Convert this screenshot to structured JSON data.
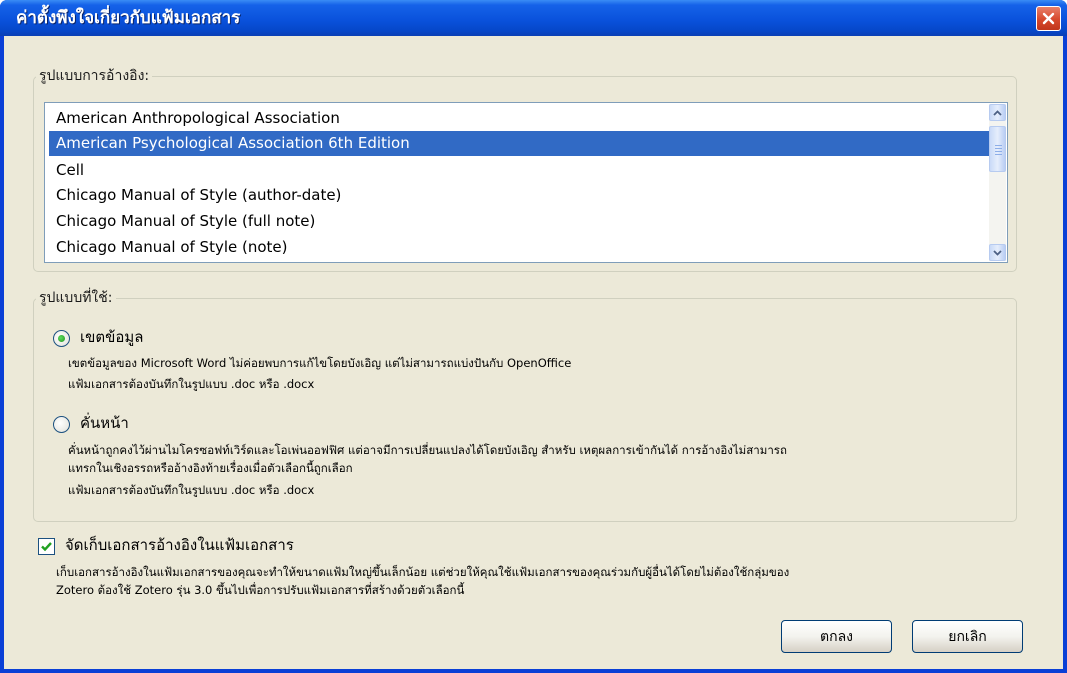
{
  "window": {
    "title": "ค่าตั้งพึงใจเกี่ยวกับแฟ้มเอกสาร"
  },
  "citation_style": {
    "legend": "รูปแบบการอ้างอิง:",
    "items": [
      "American Anthropological Association",
      "American Psychological Association 6th Edition",
      "Cell",
      "Chicago Manual of Style (author-date)",
      "Chicago Manual of Style (full note)",
      "Chicago Manual of Style (note)"
    ],
    "selected_index": 1
  },
  "format": {
    "legend": "รูปแบบที่ใช้:",
    "fields_option": {
      "label": "เขตข้อมูล",
      "checked": true,
      "desc_line1": "เขตข้อมูลของ Microsoft Word ไม่ค่อยพบการแก้ไขโดยบังเอิญ แต่ไม่สามารถแบ่งปันกับ OpenOffice",
      "desc_line2": "แฟ้มเอกสารต้องบันทึกในรูปแบบ .doc หรือ .docx"
    },
    "bookmarks_option": {
      "label": "คั่นหน้า",
      "checked": false,
      "desc_line1": "คั่นหน้าถูกคงไว้ผ่านไมโครซอฟท์เวิร์ดและโอเพ่นออฟฟิศ แต่อาจมีการเปลี่ยนแปลงได้โดยบังเอิญ สำหรับ เหตุผลการเข้ากันได้ การอ้างอิงไม่สามารถ",
      "desc_line2": "แทรกในเชิงอรรถหรืออ้างอิงท้ายเรื่องเมื่อตัวเลือกนี้ถูกเลือก",
      "desc_line3": "แฟ้มเอกสารต้องบันทึกในรูปแบบ .doc หรือ .docx"
    }
  },
  "store_references": {
    "label": "จัดเก็บเอกสารอ้างอิงในแฟ้มเอกสาร",
    "checked": true,
    "desc_line1": "เก็บเอกสารอ้างอิงในแฟ้มเอกสารของคุณจะทำให้ขนาดแฟ้มใหญ่ขึ้นเล็กน้อย แต่ช่วยให้คุณใช้แฟ้มเอกสารของคุณร่วมกับผู้อื่นได้โดยไม่ต้องใช้กลุ่มของ",
    "desc_line2": "Zotero ต้องใช้ Zotero รุ่น 3.0 ขึ้นไปเพื่อการปรับแฟ้มเอกสารที่สร้างด้วยตัวเลือกนี้"
  },
  "buttons": {
    "ok": "ตกลง",
    "cancel": "ยกเลิก"
  },
  "colors": {
    "titlebar": "#0a52dc",
    "selection": "#316ac5",
    "dialog_bg": "#ece9d8",
    "close_button": "#d7482c"
  }
}
